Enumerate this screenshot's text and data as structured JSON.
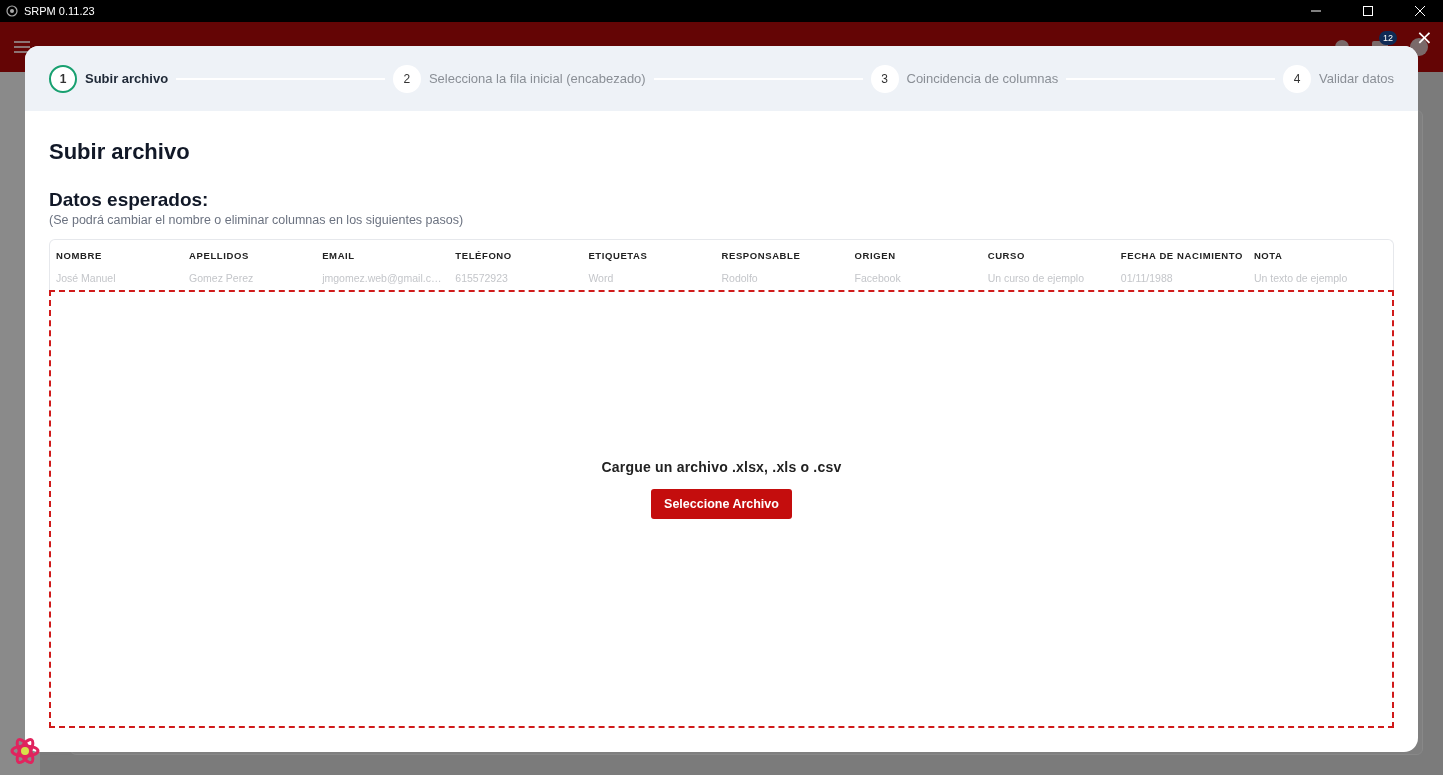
{
  "window": {
    "title": "SRPM 0.11.23"
  },
  "header": {
    "notification_count": "12"
  },
  "modal": {
    "close": "×",
    "steps": [
      {
        "number": "1",
        "label": "Subir archivo",
        "selected": true
      },
      {
        "number": "2",
        "label": "Selecciona la fila inicial (encabezado)",
        "selected": false
      },
      {
        "number": "3",
        "label": "Coincidencia de columnas",
        "selected": false
      },
      {
        "number": "4",
        "label": "Validar datos",
        "selected": false
      }
    ],
    "title": "Subir archivo",
    "expected_title": "Datos esperados:",
    "expected_note": "(Se podrá cambiar el nombre o eliminar columnas en los siguientes pasos)",
    "table": {
      "columns": [
        "NOMBRE",
        "APELLIDOS",
        "EMAIL",
        "TELÉFONO",
        "ETIQUETAS",
        "RESPONSABLE",
        "ORIGEN",
        "CURSO",
        "FECHA DE NACIMIENTO",
        "NOTA"
      ],
      "rows": [
        [
          "José Manuel",
          "Gomez Perez",
          "jmgomez.web@gmail.c…",
          "615572923",
          "Word",
          "Rodolfo",
          "Facebook",
          "Un curso de ejemplo",
          "01/11/1988",
          "Un texto de ejemplo"
        ]
      ]
    },
    "dropzone": {
      "prompt": "Cargue un archivo .xlsx, .xls o .csv",
      "button": "Seleccione Archivo"
    }
  }
}
